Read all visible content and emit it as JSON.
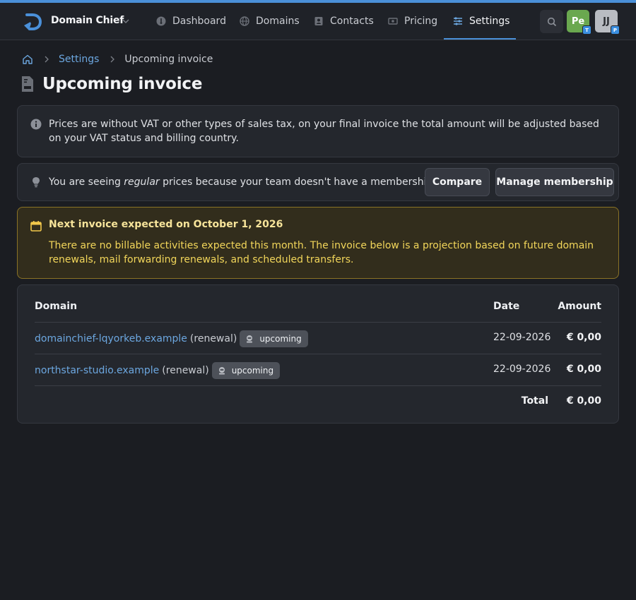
{
  "app": {
    "name": "Domain Chief"
  },
  "nav": {
    "dashboard": "Dashboard",
    "domains": "Domains",
    "contacts": "Contacts",
    "pricing": "Pricing",
    "settings": "Settings"
  },
  "user": {
    "avatar1_initials": "Pe",
    "avatar1_badge": "T",
    "avatar2_initials": "JJ",
    "avatar2_badge": "P"
  },
  "breadcrumb": {
    "parent": "Settings",
    "current": "Upcoming invoice"
  },
  "page": {
    "title": "Upcoming invoice"
  },
  "vat_notice": {
    "text": "Prices are without VAT or other types of sales tax, on your final invoice the total amount will be adjusted based on your VAT status and billing country."
  },
  "membership_notice": {
    "prefix": "You are seeing ",
    "emphasis": "regular",
    "suffix": " prices because your team doesn't have a membership.",
    "compare_label": "Compare",
    "manage_label": "Manage membership"
  },
  "next_invoice": {
    "title": "Next invoice expected on October 1, 2026",
    "description": "There are no billable activities expected this month. The invoice below is a projection based on future domain renewals, mail forwarding renewals, and scheduled transfers."
  },
  "invoice_table": {
    "headers": {
      "domain": "Domain",
      "date": "Date",
      "amount": "Amount"
    },
    "rows": [
      {
        "domain": "domainchief-lqyorkeb.example",
        "type": "(renewal)",
        "badge": "upcoming",
        "date": "22-09-2026",
        "amount": "€ 0,00"
      },
      {
        "domain": "northstar-studio.example",
        "type": "(renewal)",
        "badge": "upcoming",
        "date": "22-09-2026",
        "amount": "€ 0,00"
      }
    ],
    "total_label": "Total",
    "total_amount": "€ 0,00"
  },
  "colors": {
    "accent": "#4a90d9",
    "link": "#6ca7e0",
    "warning": "#f2d65a",
    "background": "#1b1d22"
  }
}
